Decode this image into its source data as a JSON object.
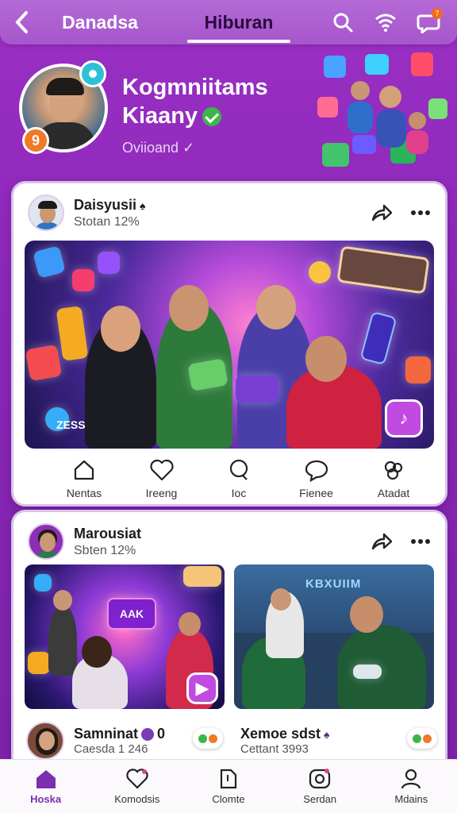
{
  "topbar": {
    "tabs": [
      {
        "label": "Danadsa"
      },
      {
        "label": "Hiburan",
        "active": true
      }
    ],
    "notification_count": "7"
  },
  "community": {
    "title": "Kogmniitams Kiaany",
    "subtitle": "Oviioand",
    "badge_b": "9"
  },
  "posts": [
    {
      "author": "Daisyusii",
      "time": "Stotan 12%",
      "media_label": "ZESS",
      "reactions": [
        {
          "label": "Nentas",
          "icon": "house-icon"
        },
        {
          "label": "Ireeng",
          "icon": "heart-icon"
        },
        {
          "label": "Ioc",
          "icon": "comment-icon"
        },
        {
          "label": "Fienee",
          "icon": "chat-icon"
        },
        {
          "label": "Atadat",
          "icon": "settings-icon"
        }
      ]
    },
    {
      "author": "Marousiat",
      "time": "Sbten 12%",
      "right_media_title": "KBXUIIM",
      "left_media_sign": "AAK",
      "subposts": [
        {
          "name": "Samninat",
          "suffix": "0",
          "time": "Caesda 1 246"
        },
        {
          "name": "Xemoe sdst",
          "time": "Cettant 3993"
        }
      ]
    }
  ],
  "bottomnav": [
    {
      "label": "Hoska",
      "icon": "home-icon",
      "active": true
    },
    {
      "label": "Komodsis",
      "icon": "heart-icon"
    },
    {
      "label": "Clomte",
      "icon": "file-icon"
    },
    {
      "label": "Serdan",
      "icon": "radio-icon"
    },
    {
      "label": "Mdains",
      "icon": "person-icon"
    }
  ],
  "colors": {
    "brand": "#8a27b8",
    "accent": "#f07a26",
    "active_nav": "#7b2fb0"
  }
}
